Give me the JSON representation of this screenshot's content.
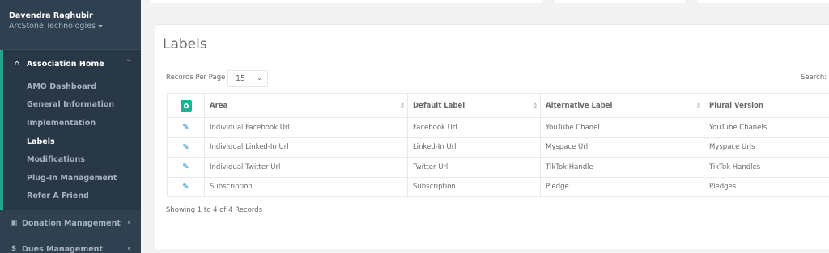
{
  "profile": {
    "name": "Davendra Raghubir",
    "org": "ArcStone Technologies"
  },
  "nav": {
    "association": {
      "label": "Association Home",
      "items": [
        "AMO Dashboard",
        "General Information",
        "Implementation",
        "Labels",
        "Modifications",
        "Plug-In Management",
        "Refer A Friend"
      ]
    },
    "donation": "Donation Management",
    "dues": "Dues Management"
  },
  "panel": {
    "title": "Labels",
    "records_per_page_label": "Records Per Page",
    "records_per_page_value": "15",
    "search_label": "Search:",
    "showing": "Showing 1 to 4 of 4 Records"
  },
  "table": {
    "headers": [
      "Area",
      "Default Label",
      "Alternative Label",
      "Plural Version"
    ],
    "rows": [
      [
        "Individual Facebook Url",
        "Facebook Url",
        "YouTube Chanel",
        "YouTube Chanels"
      ],
      [
        "Individual Linked-In Url",
        "Linked-In Url",
        "Myspace Url",
        "Myspace Urls"
      ],
      [
        "Individual Twitter Url",
        "Twitter Url",
        "TikTok Handle",
        "TikTok Handles"
      ],
      [
        "Subscription",
        "Subscription",
        "Pledge",
        "Pledges"
      ]
    ]
  },
  "colors": {
    "sidebar": "#2f4050",
    "accent": "#1ab394",
    "edit": "#1c84c6"
  },
  "icons": [
    "home-icon",
    "gift-icon",
    "dollar-icon",
    "add-icon",
    "edit-icon"
  ]
}
